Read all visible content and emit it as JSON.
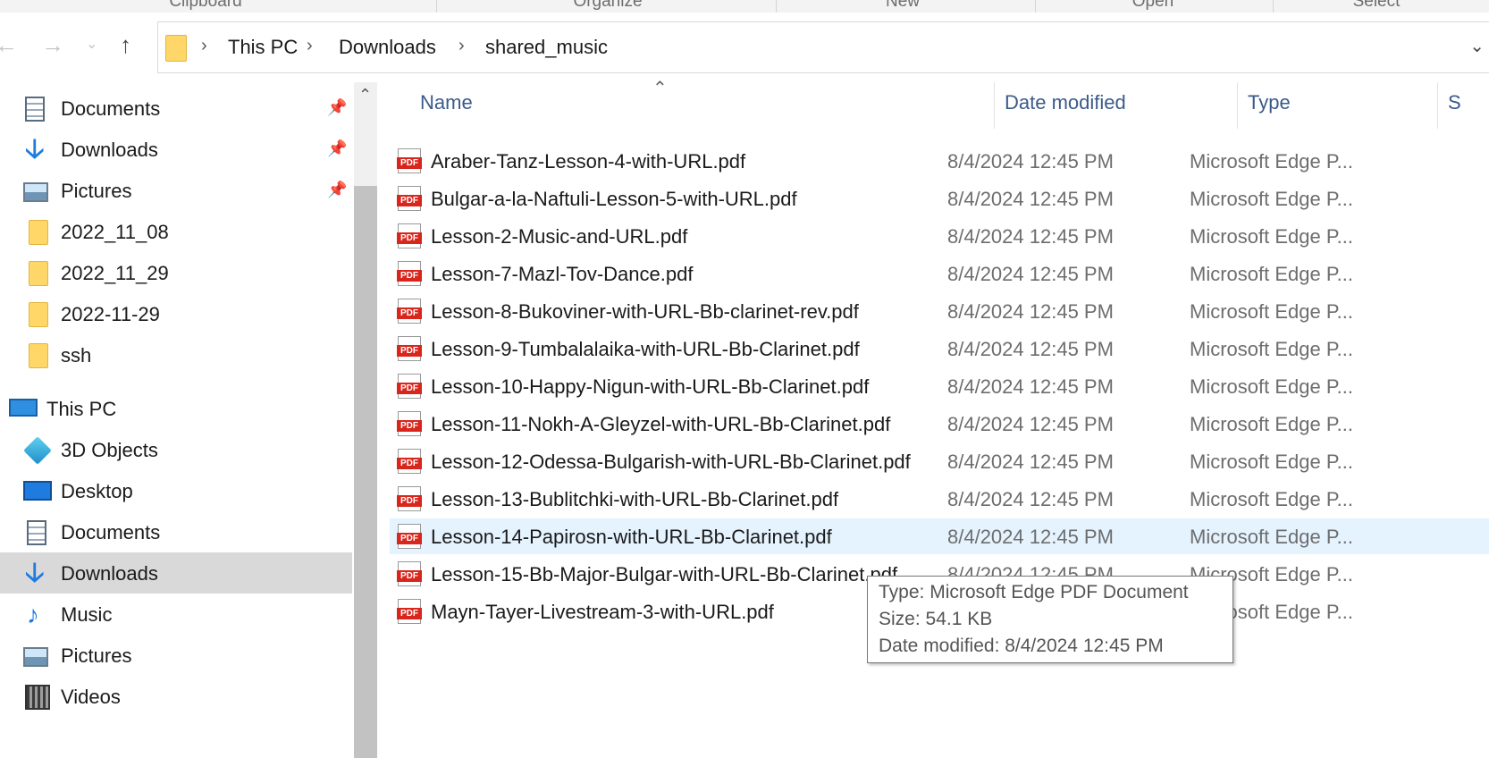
{
  "ribbon": {
    "groups": [
      "Clipboard",
      "Organize",
      "New",
      "Open",
      "Select"
    ]
  },
  "navigation": {
    "back_icon": "back-arrow-icon",
    "forward_icon": "forward-arrow-icon",
    "recent_icon": "chevron-down-icon",
    "up_icon": "up-arrow-icon",
    "breadcrumb": [
      "This PC",
      "Downloads",
      "shared_music"
    ]
  },
  "sidebar": {
    "quick_access": [
      {
        "label": "Documents",
        "icon": "documents-icon",
        "pinned": true
      },
      {
        "label": "Downloads",
        "icon": "downloads-icon",
        "pinned": true
      },
      {
        "label": "Pictures",
        "icon": "pictures-icon",
        "pinned": true
      },
      {
        "label": "2022_11_08",
        "icon": "folder-icon",
        "pinned": false
      },
      {
        "label": "2022_11_29",
        "icon": "folder-icon",
        "pinned": false
      },
      {
        "label": "2022-11-29",
        "icon": "folder-icon",
        "pinned": false
      },
      {
        "label": "ssh",
        "icon": "folder-icon",
        "pinned": false
      }
    ],
    "this_pc": {
      "label": "This PC",
      "icon": "computer-icon",
      "items": [
        {
          "label": "3D Objects",
          "icon": "3d-objects-icon"
        },
        {
          "label": "Desktop",
          "icon": "desktop-icon"
        },
        {
          "label": "Documents",
          "icon": "documents-icon"
        },
        {
          "label": "Downloads",
          "icon": "downloads-icon",
          "selected": true
        },
        {
          "label": "Music",
          "icon": "music-icon"
        },
        {
          "label": "Pictures",
          "icon": "pictures-icon"
        },
        {
          "label": "Videos",
          "icon": "videos-icon"
        }
      ]
    }
  },
  "file_list": {
    "columns": [
      "Name",
      "Date modified",
      "Type",
      "S"
    ],
    "rows": [
      {
        "name": "Araber-Tanz-Lesson-4-with-URL.pdf",
        "date": "8/4/2024 12:45 PM",
        "type": "Microsoft Edge P..."
      },
      {
        "name": "Bulgar-a-la-Naftuli-Lesson-5-with-URL.pdf",
        "date": "8/4/2024 12:45 PM",
        "type": "Microsoft Edge P..."
      },
      {
        "name": "Lesson-2-Music-and-URL.pdf",
        "date": "8/4/2024 12:45 PM",
        "type": "Microsoft Edge P..."
      },
      {
        "name": "Lesson-7-Mazl-Tov-Dance.pdf",
        "date": "8/4/2024 12:45 PM",
        "type": "Microsoft Edge P..."
      },
      {
        "name": "Lesson-8-Bukoviner-with-URL-Bb-clarinet-rev.pdf",
        "date": "8/4/2024 12:45 PM",
        "type": "Microsoft Edge P..."
      },
      {
        "name": "Lesson-9-Tumbalalaika-with-URL-Bb-Clarinet.pdf",
        "date": "8/4/2024 12:45 PM",
        "type": "Microsoft Edge P..."
      },
      {
        "name": "Lesson-10-Happy-Nigun-with-URL-Bb-Clarinet.pdf",
        "date": "8/4/2024 12:45 PM",
        "type": "Microsoft Edge P..."
      },
      {
        "name": "Lesson-11-Nokh-A-Gleyzel-with-URL-Bb-Clarinet.pdf",
        "date": "8/4/2024 12:45 PM",
        "type": "Microsoft Edge P..."
      },
      {
        "name": "Lesson-12-Odessa-Bulgarish-with-URL-Bb-Clarinet.pdf",
        "date": "8/4/2024 12:45 PM",
        "type": "Microsoft Edge P..."
      },
      {
        "name": "Lesson-13-Bublitchki-with-URL-Bb-Clarinet.pdf",
        "date": "8/4/2024 12:45 PM",
        "type": "Microsoft Edge P..."
      },
      {
        "name": "Lesson-14-Papirosn-with-URL-Bb-Clarinet.pdf",
        "date": "8/4/2024 12:45 PM",
        "type": "Microsoft Edge P...",
        "hovered": true
      },
      {
        "name": "Lesson-15-Bb-Major-Bulgar-with-URL-Bb-Clarinet.pdf",
        "date": "8/4/2024 12:45 PM",
        "type": "Microsoft Edge P..."
      },
      {
        "name": "Mayn-Tayer-Livestream-3-with-URL.pdf",
        "date": "",
        "type": "Microsoft Edge P..."
      }
    ]
  },
  "tooltip": {
    "type": "Type: Microsoft Edge PDF Document",
    "size": "Size: 54.1 KB",
    "date": "Date modified: 8/4/2024 12:45 PM"
  }
}
